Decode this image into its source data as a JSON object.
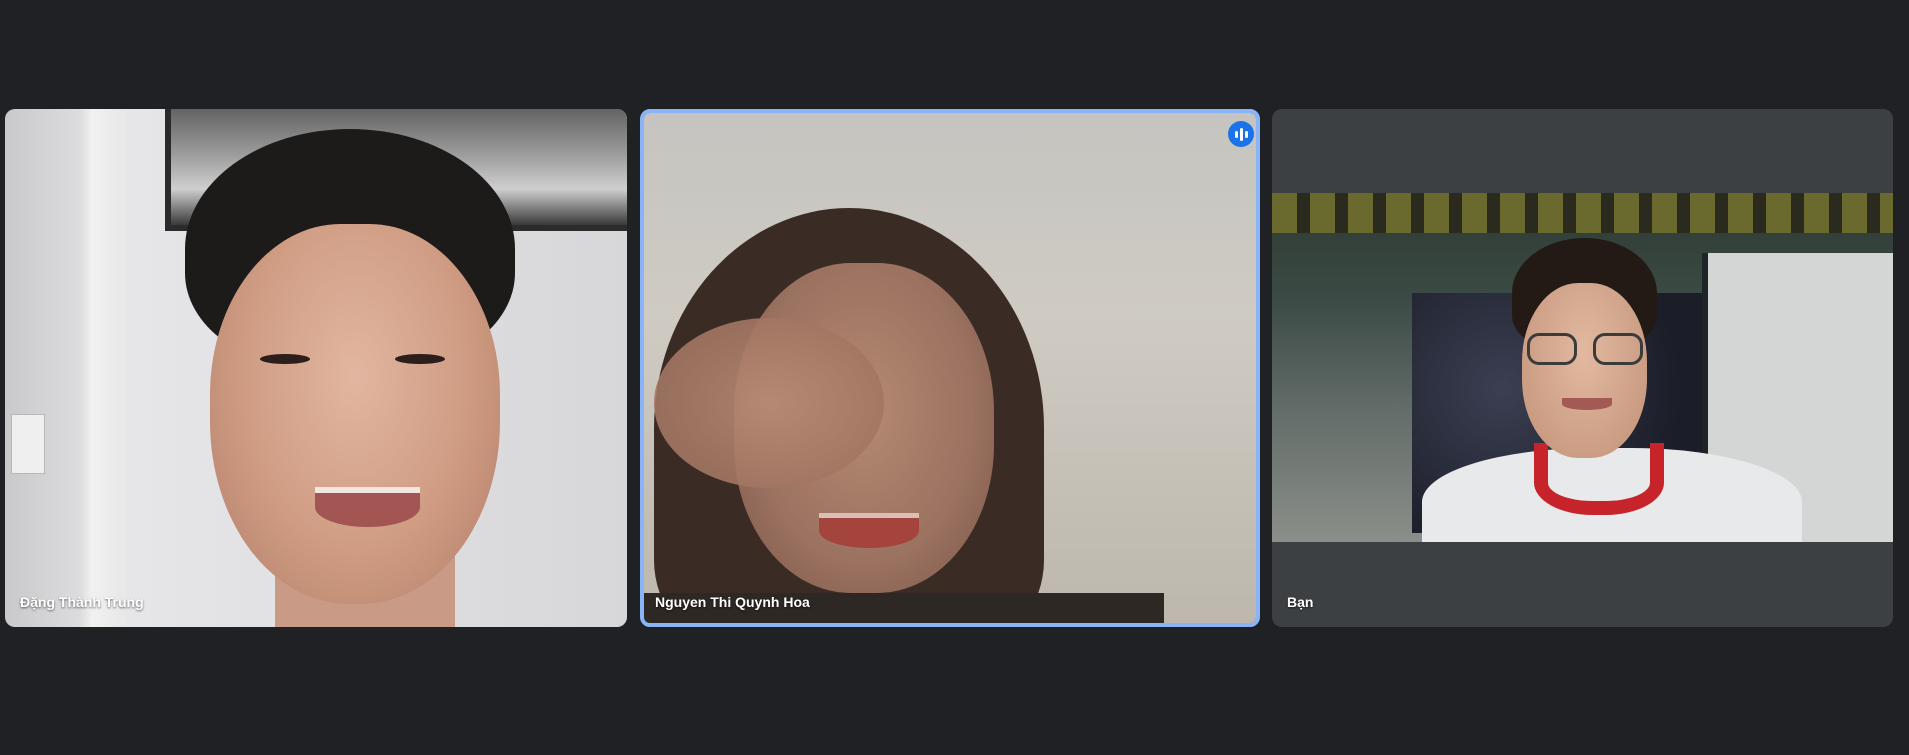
{
  "participants": [
    {
      "name": "Đặng Thành Trung",
      "speaking": false
    },
    {
      "name": "Nguyen Thi Quynh Hoa",
      "speaking": true
    },
    {
      "name": "Bạn",
      "speaking": false
    }
  ],
  "icons": {
    "speaking_indicator": "audio-level-icon"
  },
  "colors": {
    "background": "#202124",
    "tile_background": "#3c4043",
    "active_speaker_border": "#8ab4f8",
    "speaking_badge": "#1a73e8"
  }
}
